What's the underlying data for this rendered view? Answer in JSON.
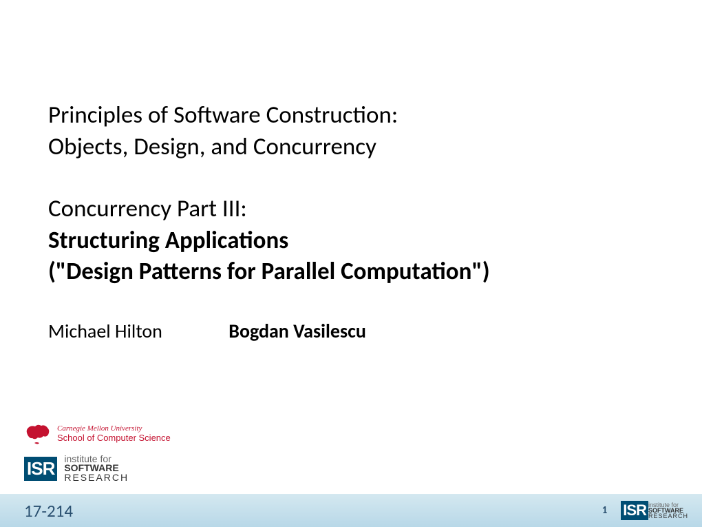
{
  "title": {
    "line1": "Principles of Software Construction:",
    "line2": "Objects, Design, and Concurrency",
    "line3": "Concurrency Part III:",
    "line4": "Structuring Applications",
    "line5": "(\"Design Patterns for Parallel Computation\")"
  },
  "authors": {
    "author1": "Michael Hilton",
    "author2": "Bogdan Vasilescu"
  },
  "logos": {
    "cmu_university": "Carnegie Mellon University",
    "cmu_school": "School of Computer Science",
    "isr_abbr": "ISR",
    "isr_line1": "institute for",
    "isr_software": "SOFTWARE",
    "isr_research": "RESEARCH"
  },
  "footer": {
    "course": "17-214",
    "page": "1"
  }
}
